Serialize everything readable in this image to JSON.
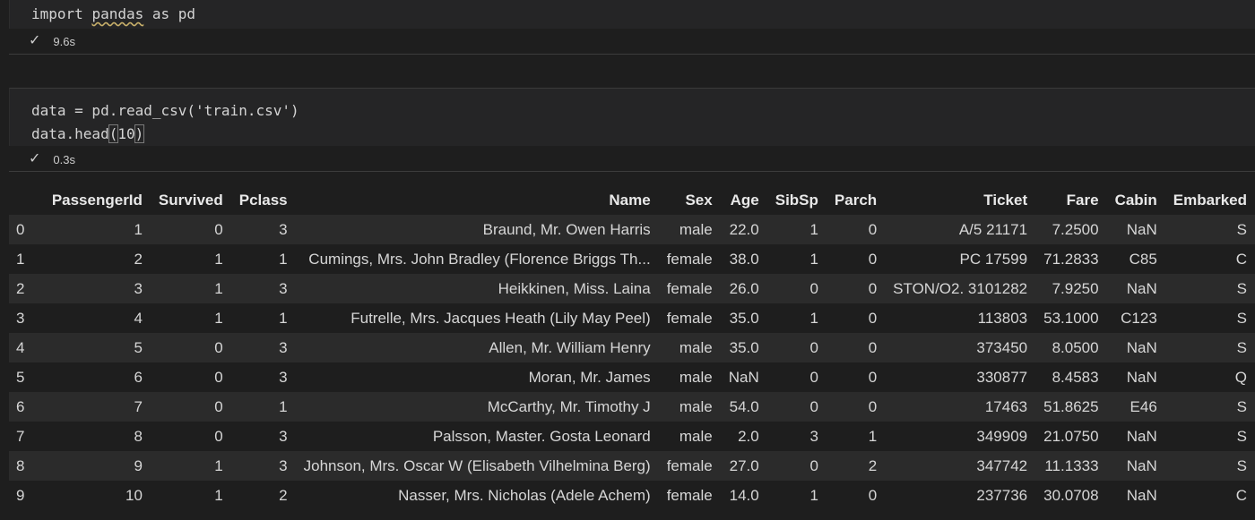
{
  "cells": [
    {
      "code_lines": [
        "import pandas as pd"
      ],
      "exec_time": "9.6s"
    },
    {
      "code_lines": [
        "data = pd.read_csv('train.csv')",
        "data.head(10)"
      ],
      "exec_time": "0.3s"
    }
  ],
  "table": {
    "columns": [
      "",
      "PassengerId",
      "Survived",
      "Pclass",
      "Name",
      "Sex",
      "Age",
      "SibSp",
      "Parch",
      "Ticket",
      "Fare",
      "Cabin",
      "Embarked"
    ],
    "rows": [
      [
        "0",
        "1",
        "0",
        "3",
        "Braund, Mr. Owen Harris",
        "male",
        "22.0",
        "1",
        "0",
        "A/5 21171",
        "7.2500",
        "NaN",
        "S"
      ],
      [
        "1",
        "2",
        "1",
        "1",
        "Cumings, Mrs. John Bradley (Florence Briggs Th...",
        "female",
        "38.0",
        "1",
        "0",
        "PC 17599",
        "71.2833",
        "C85",
        "C"
      ],
      [
        "2",
        "3",
        "1",
        "3",
        "Heikkinen, Miss. Laina",
        "female",
        "26.0",
        "0",
        "0",
        "STON/O2. 3101282",
        "7.9250",
        "NaN",
        "S"
      ],
      [
        "3",
        "4",
        "1",
        "1",
        "Futrelle, Mrs. Jacques Heath (Lily May Peel)",
        "female",
        "35.0",
        "1",
        "0",
        "113803",
        "53.1000",
        "C123",
        "S"
      ],
      [
        "4",
        "5",
        "0",
        "3",
        "Allen, Mr. William Henry",
        "male",
        "35.0",
        "0",
        "0",
        "373450",
        "8.0500",
        "NaN",
        "S"
      ],
      [
        "5",
        "6",
        "0",
        "3",
        "Moran, Mr. James",
        "male",
        "NaN",
        "0",
        "0",
        "330877",
        "8.4583",
        "NaN",
        "Q"
      ],
      [
        "6",
        "7",
        "0",
        "1",
        "McCarthy, Mr. Timothy J",
        "male",
        "54.0",
        "0",
        "0",
        "17463",
        "51.8625",
        "E46",
        "S"
      ],
      [
        "7",
        "8",
        "0",
        "3",
        "Palsson, Master. Gosta Leonard",
        "male",
        "2.0",
        "3",
        "1",
        "349909",
        "21.0750",
        "NaN",
        "S"
      ],
      [
        "8",
        "9",
        "1",
        "3",
        "Johnson, Mrs. Oscar W (Elisabeth Vilhelmina Berg)",
        "female",
        "27.0",
        "0",
        "2",
        "347742",
        "11.1333",
        "NaN",
        "S"
      ],
      [
        "9",
        "10",
        "1",
        "2",
        "Nasser, Mrs. Nicholas (Adele Achem)",
        "female",
        "14.0",
        "1",
        "0",
        "237736",
        "30.0708",
        "NaN",
        "C"
      ]
    ]
  },
  "icons": {
    "success": "checkmark-icon"
  },
  "colors": {
    "background": "#1e1e1e",
    "editor": "#252526",
    "row_stripe": "#2b2b2b"
  }
}
